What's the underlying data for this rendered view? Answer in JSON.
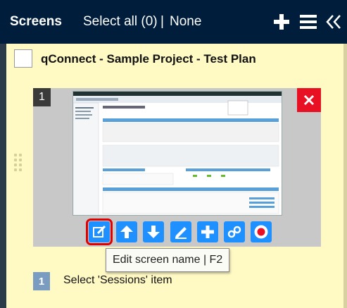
{
  "header": {
    "title": "Screens",
    "select_all_label": "Select all (0)",
    "separator": "|",
    "none_label": "None",
    "background": "#001e3c"
  },
  "project": {
    "title": "qConnect - Sample Project - Test Plan"
  },
  "screen_card": {
    "number": "1",
    "toolbar": [
      {
        "icon": "edit-icon",
        "name": "edit-screen-name-button"
      },
      {
        "icon": "arrow-up-icon",
        "name": "move-up-button"
      },
      {
        "icon": "arrow-down-icon",
        "name": "move-down-button"
      },
      {
        "icon": "pen-icon",
        "name": "annotate-button"
      },
      {
        "icon": "plus-icon",
        "name": "insert-button"
      },
      {
        "icon": "link-icon",
        "name": "link-button"
      },
      {
        "icon": "record-icon",
        "name": "record-button"
      }
    ],
    "tooltip": "Edit screen name | F2"
  },
  "step": {
    "number": "1",
    "text": "Select 'Sessions' item"
  },
  "colors": {
    "accent": "#1e90ff",
    "delete": "#e81123",
    "panel_background": "#fff9c4",
    "selected_outline": "#e00000"
  }
}
